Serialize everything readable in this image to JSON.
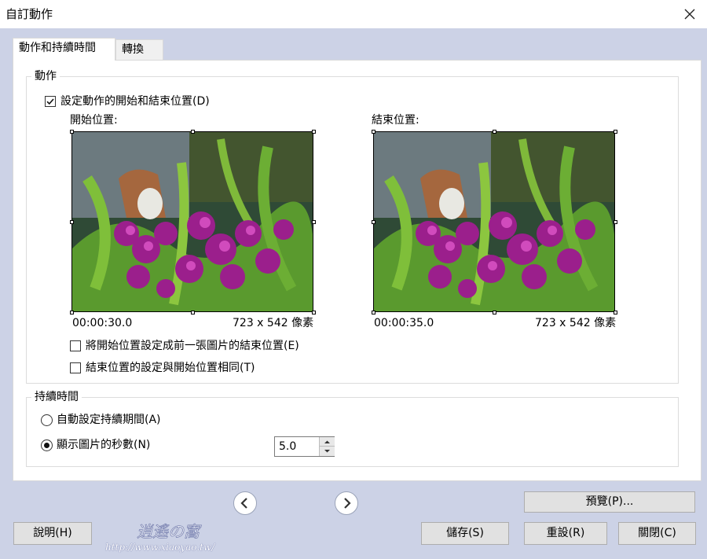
{
  "window": {
    "title": "自訂動作"
  },
  "tabs": [
    {
      "label": "動作和持續時間"
    },
    {
      "label": "轉換"
    }
  ],
  "motion": {
    "group_label": "動作",
    "enable_label": "設定動作的開始和結束位置(D)",
    "enable_checked": true,
    "start": {
      "label": "開始位置:",
      "time": "00:00:30.0",
      "size": "723 x 542 像素"
    },
    "end": {
      "label": "結束位置:",
      "time": "00:00:35.0",
      "size": "723 x 542 像素"
    },
    "option_prev_end": "將開始位置設定成前一張圖片的結束位置(E)",
    "option_same": "結束位置的設定與開始位置相同(T)"
  },
  "duration": {
    "group_label": "持續時間",
    "auto_label": "自動設定持續期間(A)",
    "seconds_label": "顯示圖片的秒數(N)",
    "seconds_value": "5.0",
    "selected": "seconds"
  },
  "buttons": {
    "preview": "預覽(P)...",
    "help": "說明(H)",
    "save": "儲存(S)",
    "reset": "重設(R)",
    "close": "關閉(C)"
  },
  "watermark": {
    "text": "http://www.xiaoyao.tw/"
  }
}
